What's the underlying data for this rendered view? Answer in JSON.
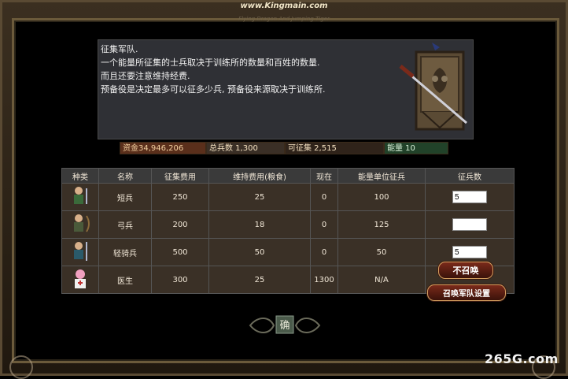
{
  "site_banner": "www.Kingmain.com",
  "subtitle": "Flying Dragon And Jumping Tiger",
  "description": {
    "lines": [
      "征集军队.",
      "一个能量所征集的士兵取决于训练所的数量和百姓的数量.",
      "而且还要注意维持经费.",
      "预备役是决定最多可以征多少兵, 预备役来源取决于训练所."
    ]
  },
  "stats": {
    "gold": "资金34,946,206",
    "total_troops": "总兵数 1,300",
    "recruitable": "可征集 2,515",
    "energy": "能量 10"
  },
  "table": {
    "headers": [
      "种类",
      "名称",
      "征集费用",
      "维持费用(粮食)",
      "现在",
      "能量单位征兵",
      "征兵数"
    ],
    "rows": [
      {
        "icon": "swordsman-icon",
        "name": "短兵",
        "cost": "250",
        "upkeep": "25",
        "current": "0",
        "per_energy": "100",
        "input": "5"
      },
      {
        "icon": "archer-icon",
        "name": "弓兵",
        "cost": "200",
        "upkeep": "18",
        "current": "0",
        "per_energy": "125",
        "input": ""
      },
      {
        "icon": "light-cavalry-icon",
        "name": "轻骑兵",
        "cost": "500",
        "upkeep": "50",
        "current": "0",
        "per_energy": "50",
        "input": "5"
      },
      {
        "icon": "doctor-icon",
        "name": "医生",
        "cost": "300",
        "upkeep": "25",
        "current": "1300",
        "per_energy": "N/A"
      }
    ]
  },
  "buttons": {
    "no_recruit": "不召唤",
    "settings": "召唤军队设置"
  },
  "ornament_label": "确",
  "watermark": "265G.com",
  "colors": {
    "accent_red": "#5a2f1b",
    "energy_green": "#214229",
    "panel": "#2f3035"
  }
}
